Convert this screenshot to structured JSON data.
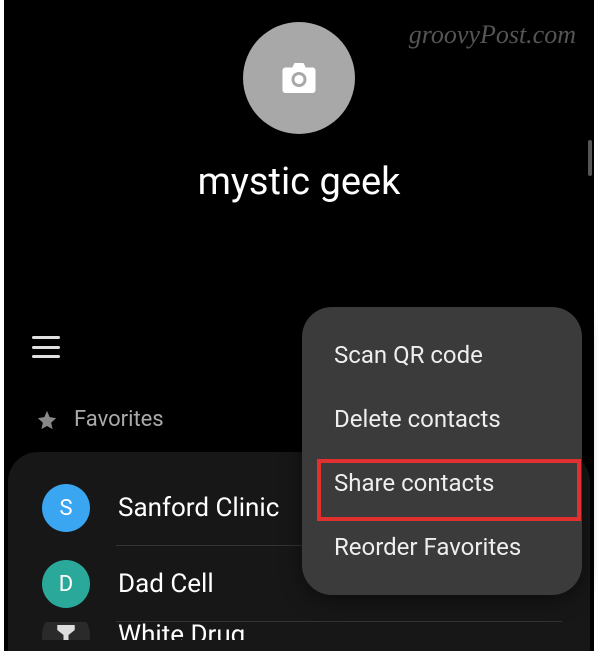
{
  "watermark": "groovyPost.com",
  "profile": {
    "name": "mystic geek"
  },
  "section": {
    "label": "Favorites"
  },
  "contacts": [
    {
      "initial": "S",
      "name": "Sanford Clinic",
      "avatar_color": "avatar-blue"
    },
    {
      "initial": "D",
      "name": "Dad Cell",
      "avatar_color": "avatar-teal"
    },
    {
      "initial": "",
      "name": "White Drug",
      "avatar_color": "avatar-dark"
    }
  ],
  "menu": {
    "items": [
      {
        "label": "Scan QR code"
      },
      {
        "label": "Delete contacts"
      },
      {
        "label": "Share contacts"
      },
      {
        "label": "Reorder Favorites"
      }
    ]
  }
}
